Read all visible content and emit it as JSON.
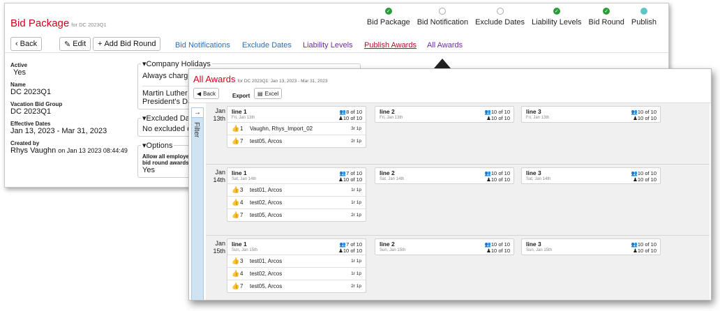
{
  "bid_package": {
    "title": "Bid Package",
    "for": "for DC 2023Q1",
    "steps": [
      {
        "label": "Bid Package",
        "state": "done"
      },
      {
        "label": "Bid Notification",
        "state": "empty"
      },
      {
        "label": "Exclude Dates",
        "state": "empty"
      },
      {
        "label": "Liability Levels",
        "state": "done"
      },
      {
        "label": "Bid Round",
        "state": "done"
      },
      {
        "label": "Publish",
        "state": "current"
      }
    ],
    "buttons": {
      "back": "Back",
      "edit": "Edit",
      "add": "Add Bid Round"
    },
    "tabs": {
      "notifications": "Bid Notifications",
      "exclude": "Exclude Dates",
      "liability": "Liability Levels",
      "publish": "Publish Awards",
      "all": "All Awards"
    },
    "fields": {
      "active_label": "Active",
      "active_value": "Yes",
      "name_label": "Name",
      "name_value": "DC 2023Q1",
      "group_label": "Vacation Bid Group",
      "group_value": "DC 2023Q1",
      "dates_label": "Effective Dates",
      "dates_value": "Jan 13, 2023 - Mar 31, 2023",
      "created_label": "Created by",
      "created_value": "Rhys Vaughn",
      "created_on": "on Jan 13 2023 08:44:49"
    },
    "holidays": {
      "legend": "Company Holidays",
      "line1": "Always charge a",
      "line2": "Martin Luther K",
      "line3": "President's Day"
    },
    "excluded": {
      "legend": "Excluded Dat",
      "line1": "No excluded da"
    },
    "options": {
      "legend": "Options",
      "line1": "Allow all employed",
      "line2": "bid round awards",
      "line3": "Yes"
    }
  },
  "all_awards": {
    "title": "All Awards",
    "for": "for DC 2023Q1: Jan 13, 2023 - Mar 31, 2023",
    "back": "Back",
    "export": "Export",
    "excel": "Excel",
    "filter": "Filter",
    "days": [
      {
        "month": "Jan",
        "day": "13th",
        "lines": [
          {
            "name": "line 1",
            "date": "Fri, Jan 13th",
            "c1": "8 of 10",
            "c2": "10 of 10",
            "awards": [
              {
                "num": "1",
                "name": "Vaughn, Rhys_Import_02",
                "rank": "3r 1p"
              },
              {
                "num": "7",
                "name": "test05, Arcos",
                "rank": "2r 1p"
              }
            ]
          },
          {
            "name": "line 2",
            "date": "Fri, Jan 13th",
            "c1": "10 of 10",
            "c2": "10 of 10",
            "awards": []
          },
          {
            "name": "line 3",
            "date": "Fri, Jan 13th",
            "c1": "10 of 10",
            "c2": "10 of 10",
            "awards": []
          }
        ]
      },
      {
        "month": "Jan",
        "day": "14th",
        "lines": [
          {
            "name": "line 1",
            "date": "Sat, Jan 14th",
            "c1": "7 of 10",
            "c2": "10 of 10",
            "awards": [
              {
                "num": "3",
                "name": "test01, Arcos",
                "rank": "1r 1p"
              },
              {
                "num": "4",
                "name": "test02, Arcos",
                "rank": "1r 1p"
              },
              {
                "num": "7",
                "name": "test05, Arcos",
                "rank": "2r 1p"
              }
            ]
          },
          {
            "name": "line 2",
            "date": "Sat, Jan 14th",
            "c1": "10 of 10",
            "c2": "10 of 10",
            "awards": []
          },
          {
            "name": "line 3",
            "date": "Sat, Jan 14th",
            "c1": "10 of 10",
            "c2": "10 of 10",
            "awards": []
          }
        ]
      },
      {
        "month": "Jan",
        "day": "15th",
        "lines": [
          {
            "name": "line 1",
            "date": "Sun, Jan 15th",
            "c1": "7 of 10",
            "c2": "10 of 10",
            "awards": [
              {
                "num": "3",
                "name": "test01, Arcos",
                "rank": "1r 1p"
              },
              {
                "num": "4",
                "name": "test02, Arcos",
                "rank": "1r 1p"
              },
              {
                "num": "7",
                "name": "test05, Arcos",
                "rank": "2r 1p"
              }
            ]
          },
          {
            "name": "line 2",
            "date": "Sun, Jan 15th",
            "c1": "10 of 10",
            "c2": "10 of 10",
            "awards": []
          },
          {
            "name": "line 3",
            "date": "Sun, Jan 15th",
            "c1": "10 of 10",
            "c2": "10 of 10",
            "awards": []
          }
        ]
      }
    ]
  },
  "colors": {
    "title_red": "#d0021b",
    "done_green": "#2a9d3a",
    "publish_teal": "#5fc6c8",
    "link_blue": "#2a6fb3"
  }
}
